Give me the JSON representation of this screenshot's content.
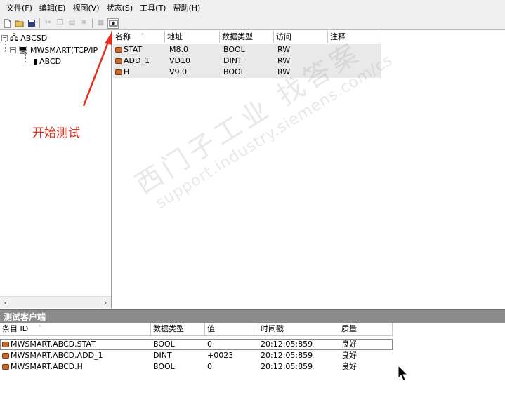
{
  "menu": [
    "文件(F)",
    "编辑(E)",
    "视图(V)",
    "状态(S)",
    "工具(T)",
    "帮助(H)"
  ],
  "toolbar": {
    "icons": [
      "new-file-icon",
      "open-folder-icon",
      "save-icon",
      "cut-icon",
      "copy-icon",
      "paste-icon",
      "delete-icon",
      "properties-icon",
      "start-test-icon"
    ]
  },
  "tree": {
    "root": "ABCSD",
    "channel": "MWSMART(TCP/IP",
    "device": "ABCD"
  },
  "tag_list": {
    "columns": [
      "名称",
      "地址",
      "数据类型",
      "访问",
      "注释"
    ],
    "rows": [
      {
        "name": "STAT",
        "address": "M8.0",
        "type": "BOOL",
        "access": "RW"
      },
      {
        "name": "ADD_1",
        "address": "VD10",
        "type": "DINT",
        "access": "RW"
      },
      {
        "name": "H",
        "address": "V9.0",
        "type": "BOOL",
        "access": "RW"
      }
    ]
  },
  "annotation": "开始测试",
  "annotation_color": "#e0301e",
  "watermark": {
    "line1": "西门子工业  找答案",
    "line2": "support.industry.siemens.com/cs"
  },
  "test_client": {
    "title": "测试客户端",
    "columns": [
      "条目 ID",
      "数据类型",
      "值",
      "时间戳",
      "质量"
    ],
    "rows": [
      {
        "id": "MWSMART.ABCD.STAT",
        "type": "BOOL",
        "value": "0",
        "timestamp": "20:12:05:859",
        "quality": "良好"
      },
      {
        "id": "MWSMART.ABCD.ADD_1",
        "type": "DINT",
        "value": "+0023",
        "timestamp": "20:12:05:859",
        "quality": "良好"
      },
      {
        "id": "MWSMART.ABCD.H",
        "type": "BOOL",
        "value": "0",
        "timestamp": "20:12:05:859",
        "quality": "良好"
      }
    ]
  }
}
